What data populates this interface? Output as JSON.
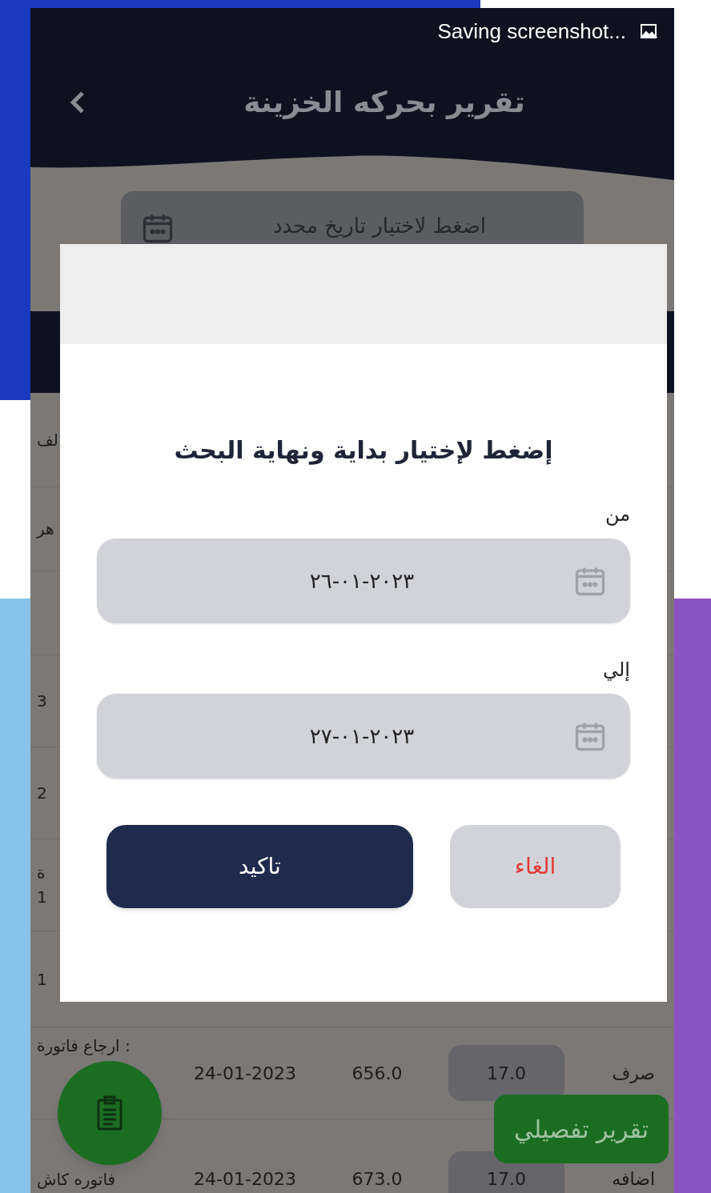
{
  "status_bar": {
    "notification": "Saving screenshot..."
  },
  "header": {
    "title": "تقرير بحركه الخزينة"
  },
  "date_filter": {
    "placeholder": "اضغط لاختيار تاريخ محدد"
  },
  "rows": [
    {
      "column_1": "لف"
    },
    {
      "column_1": "هر"
    },
    {},
    {
      "column_1": "3"
    },
    {
      "column_1": "2"
    },
    {
      "column_1": "ة",
      "column_1_line_2": "1"
    },
    {
      "column_1": "1"
    },
    {
      "column_1": "ارجاع فاتورة :",
      "date": "24-01-2023",
      "amount": "656.0",
      "quantity": "17.0",
      "type": "صرف"
    },
    {
      "column_1": "فاتوره كاش",
      "date": "24-01-2023",
      "amount": "673.0",
      "quantity": "17.0",
      "type": "اضافه"
    }
  ],
  "detail_report_button": "تقرير تفصيلي",
  "dialog": {
    "title": "إضغط لإختيار بداية ونهاية البحث",
    "fields": [
      {
        "label": "من",
        "value": "٢٠٢٣-٠١-٢٦"
      },
      {
        "label": "إلي",
        "value": "٢٠٢٣-٠١-٢٧"
      }
    ],
    "buttons": [
      {
        "kind": "cancel",
        "label": "الغاء"
      },
      {
        "kind": "confirm",
        "label": "تاكيد"
      }
    ]
  }
}
